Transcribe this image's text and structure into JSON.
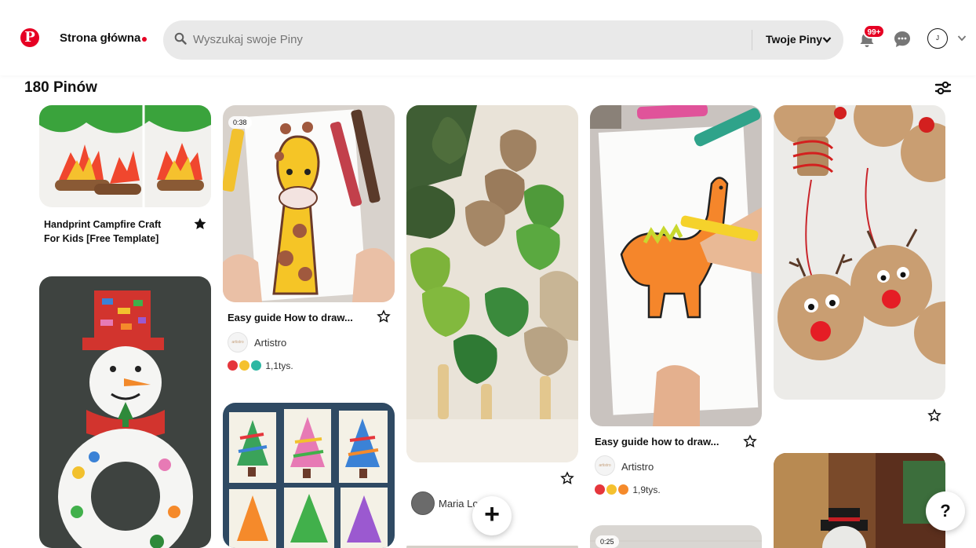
{
  "header": {
    "logo": "P",
    "home_label": "Strona główna",
    "search_placeholder": "Wyszukaj swoje Piny",
    "my_pins_label": "Twoje Piny",
    "notifications_count": "99+",
    "avatar_initial": "J"
  },
  "board": {
    "pin_count_label": "180 Pinów"
  },
  "pins": {
    "campfire": {
      "title_line1": "Handprint Campfire Craft",
      "title_line2": "For Kids [Free Template]"
    },
    "giraffe": {
      "video_time": "0:38",
      "title": "Easy guide How to draw...",
      "creator": "Artistro",
      "creator_logo": "artistro",
      "reactions": "1,1tys."
    },
    "dino": {
      "title": "Easy guide how to draw...",
      "creator": "Artistro",
      "creator_logo": "artistro",
      "reactions": "1,9tys."
    },
    "trees_felt": {
      "creator": "Maria Lo"
    },
    "bottom_video": {
      "video_time": "0:25"
    }
  },
  "fab": {
    "add_label": "+",
    "help_label": "?"
  },
  "colors": {
    "brand": "#e60023",
    "search_bg": "#e9e9e9"
  },
  "icons": [
    "pinterest-logo-icon",
    "search-icon",
    "chevron-down-icon",
    "bell-icon",
    "message-icon",
    "filter-icon",
    "star-icon",
    "plus-icon",
    "help-icon"
  ]
}
